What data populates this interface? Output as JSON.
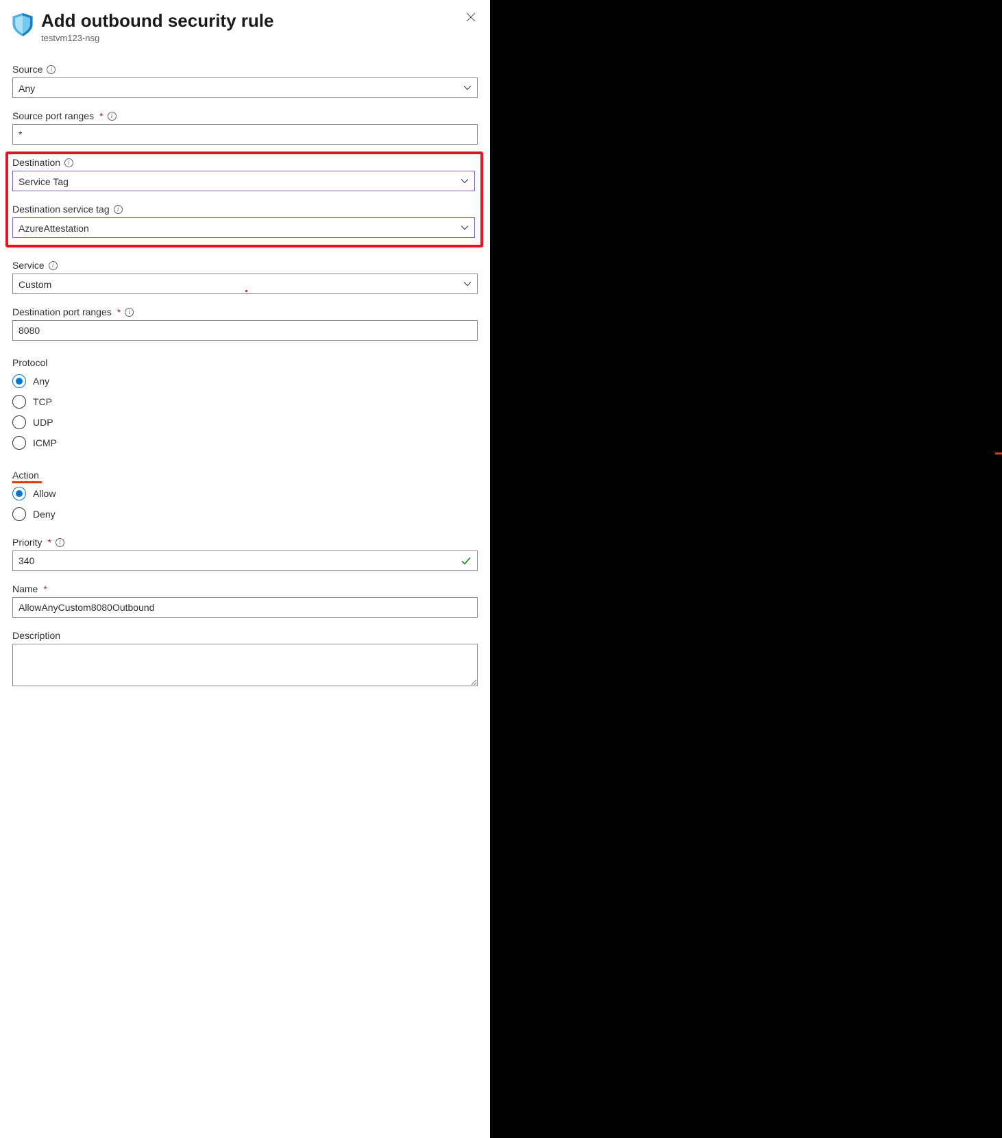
{
  "header": {
    "title": "Add outbound security rule",
    "subtitle": "testvm123-nsg"
  },
  "fields": {
    "source": {
      "label": "Source",
      "value": "Any"
    },
    "sourcePortRanges": {
      "label": "Source port ranges",
      "value": "*"
    },
    "destination": {
      "label": "Destination",
      "value": "Service Tag"
    },
    "destServiceTag": {
      "label": "Destination service tag",
      "value": "AzureAttestation"
    },
    "service": {
      "label": "Service",
      "value": "Custom"
    },
    "destPortRanges": {
      "label": "Destination port ranges",
      "value": "8080"
    },
    "protocol": {
      "label": "Protocol",
      "options": [
        {
          "key": "any",
          "label": "Any",
          "selected": true
        },
        {
          "key": "tcp",
          "label": "TCP",
          "selected": false
        },
        {
          "key": "udp",
          "label": "UDP",
          "selected": false
        },
        {
          "key": "icmp",
          "label": "ICMP",
          "selected": false
        }
      ]
    },
    "action": {
      "label": "Action",
      "options": [
        {
          "key": "allow",
          "label": "Allow",
          "selected": true
        },
        {
          "key": "deny",
          "label": "Deny",
          "selected": false
        }
      ]
    },
    "priority": {
      "label": "Priority",
      "value": "340"
    },
    "name": {
      "label": "Name",
      "value": "AllowAnyCustom8080Outbound"
    },
    "description": {
      "label": "Description",
      "value": ""
    }
  }
}
